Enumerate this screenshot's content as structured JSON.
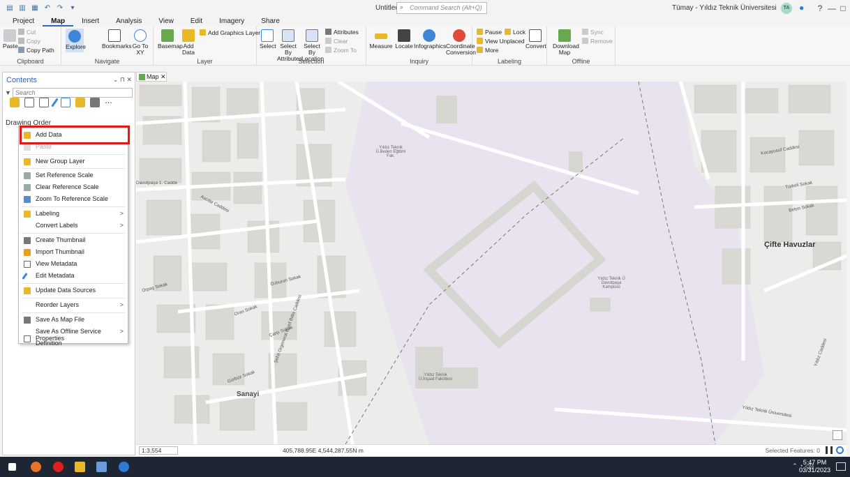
{
  "titlebar": {
    "doc_title": "Untitled",
    "search_placeholder": "Command Search (Alt+Q)",
    "user": "Tümay - Yıldız Teknik Üniversitesi",
    "avatar_initials": "TA",
    "help": "?",
    "minimize": "—",
    "maximize": "□",
    "close": "✕"
  },
  "tabs": [
    "Project",
    "Map",
    "Insert",
    "Analysis",
    "View",
    "Edit",
    "Imagery",
    "Share"
  ],
  "ribbon": {
    "clipboard": {
      "paste": "Paste",
      "cut": "Cut",
      "copy": "Copy",
      "copy_path": "Copy Path",
      "label": "Clipboard"
    },
    "navigate": {
      "explore": "Explore",
      "bookmarks": "Bookmarks",
      "goto": "Go To XY",
      "label": "Navigate"
    },
    "layer": {
      "basemap": "Basemap",
      "add_data": "Add Data",
      "add_graphics": "Add Graphics Layer",
      "label": "Layer"
    },
    "selection": {
      "select": "Select",
      "by_attributes": "Select By Attributes",
      "by_location": "Select By Location",
      "attributes": "Attributes",
      "clear": "Clear",
      "zoom_to": "Zoom To",
      "label": "Selection"
    },
    "inquiry": {
      "measure": "Measure",
      "locate": "Locate",
      "infographics": "Infographics",
      "coord_conv": "Coordinate Conversion",
      "label": "Inquiry"
    },
    "labeling": {
      "pause": "Pause",
      "lock": "Lock",
      "view_unplaced": "View Unplaced",
      "more": "More",
      "convert": "Convert",
      "label": "Labeling"
    },
    "offline": {
      "download": "Download Map",
      "sync": "Sync",
      "remove": "Remove",
      "label": "Offline"
    }
  },
  "contents": {
    "title": "Contents",
    "search_placeholder": "Search",
    "drawing_order": "Drawing Order"
  },
  "context_menu": {
    "items": [
      {
        "label": "Add Data",
        "arrow": ""
      },
      {
        "label": "Paste",
        "arrow": ""
      },
      {
        "label": "New Group Layer",
        "arrow": ""
      },
      {
        "label": "Set Reference Scale",
        "arrow": ""
      },
      {
        "label": "Clear Reference Scale",
        "arrow": ""
      },
      {
        "label": "Zoom To Reference Scale",
        "arrow": ""
      },
      {
        "label": "Labeling",
        "arrow": ">"
      },
      {
        "label": "Convert Labels",
        "arrow": ">"
      },
      {
        "label": "Create Thumbnail",
        "arrow": ""
      },
      {
        "label": "Import Thumbnail",
        "arrow": ""
      },
      {
        "label": "View Metadata",
        "arrow": ""
      },
      {
        "label": "Edit Metadata",
        "arrow": ""
      },
      {
        "label": "Update Data Sources",
        "arrow": ""
      },
      {
        "label": "Reorder Layers",
        "arrow": ">"
      },
      {
        "label": "Save As Map File",
        "arrow": ""
      },
      {
        "label": "Save As Offline Service Definition",
        "arrow": ">"
      },
      {
        "label": "Properties",
        "arrow": ""
      }
    ]
  },
  "map": {
    "tab_label": "Map",
    "labels": {
      "cifte_havuzlar": "Çifte Havuzlar",
      "sanayi": "Sanayi",
      "ytu_davutpasa": "Yıldız Teknik Ü Davutpaşa Kampüsü",
      "ytu_beden": "Yıldız Teknik Ü.Beden Eğitimi Fak.",
      "ytu_insaat": "Yıldız Teknik Ü.İnşaat Fakültesi",
      "davutpasa_caddesi": "Davutpaşa 1. Cadde",
      "avcilar_caddesi": "Avcılar Caddesi",
      "orpas_sokak": "Orpaş Sokak",
      "ozburun_sokak": "Özburun Sokak",
      "oran_sokak": "Oran Sokak",
      "carsi_sokak": "Çarşı Sokak",
      "gurbuz_sokak": "Gürbüz Sokak",
      "yildiz_teknik_universitesi": "Yıldız Teknik Üniversitesi",
      "koruyucu_caddesi": "Kocayusuf Caddesi",
      "sehit_caddesi": "Şehit Orgeneral Eşref Bitlis Caddesi",
      "turkeli_sokak": "Türkeli Sokak",
      "baskent_sokak": "Beton Sokak",
      "yildiz_caddesi": "Yıldız Caddesi"
    }
  },
  "status": {
    "scale": "1:3,554",
    "coords": "405,788.95E 4,544,287.55N m",
    "selected": "Selected Features: 0"
  },
  "taskbar": {
    "time": "5:47 PM",
    "date": "03/31/2023"
  },
  "colors": {
    "accent": "#2b66c8",
    "highlight_red": "#e01818",
    "campus": "#e8e3ee",
    "building": "#d9d8d3"
  }
}
